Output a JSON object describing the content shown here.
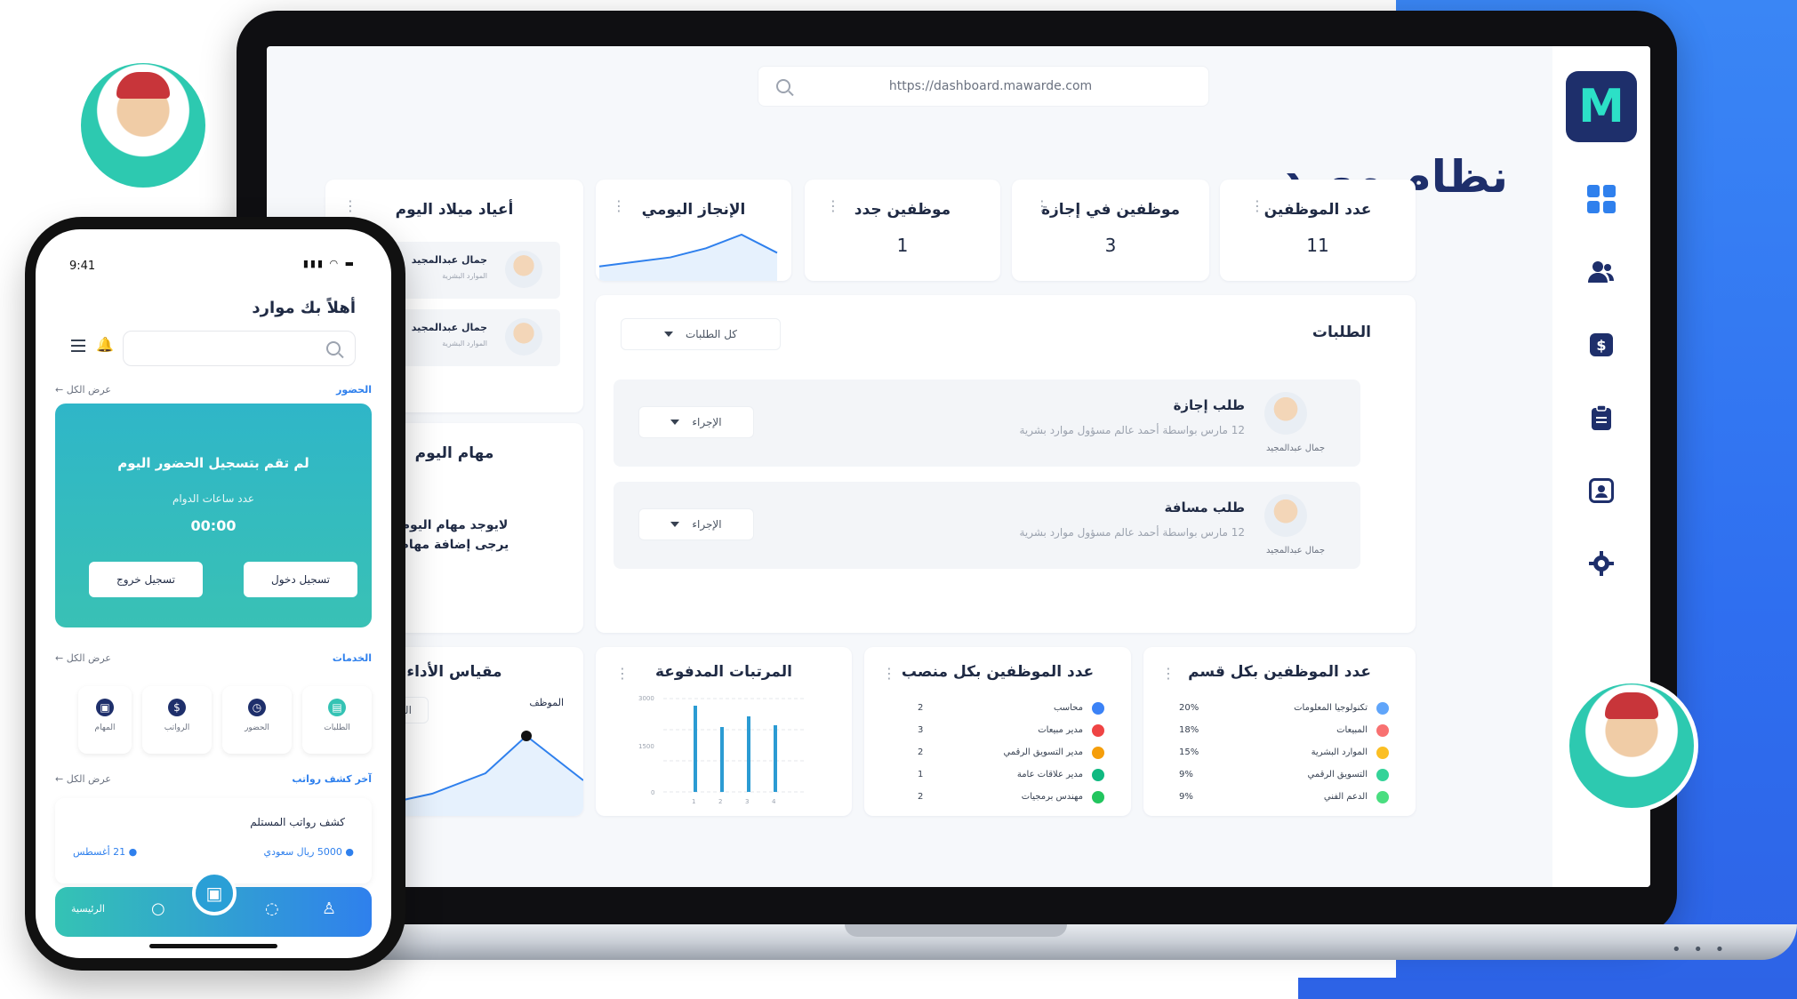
{
  "brand": {
    "logo_letter": "M",
    "accent": "#2f80ed",
    "navy": "#1e2f6b",
    "teal": "#34c3b4"
  },
  "browser": {
    "url": "https://dashboard.mawarde.com"
  },
  "page": {
    "title": "نظام مورد"
  },
  "sidebar": {
    "icons": [
      "dashboard-grid-icon",
      "users-icon",
      "dollar-icon",
      "clipboard-icon",
      "id-card-icon",
      "gear-icon"
    ]
  },
  "stats": [
    {
      "label": "عدد الموظفين",
      "value": "11"
    },
    {
      "label": "موظفين في إجازة",
      "value": "3"
    },
    {
      "label": "موظفين جدد",
      "value": "1"
    }
  ],
  "daily": {
    "title": "الإنجاز اليومي",
    "line": [
      2,
      3,
      4,
      6,
      9,
      5
    ]
  },
  "birthdays": {
    "title": "أعياد ميلاد اليوم",
    "items": [
      {
        "name": "جمال عبدالمجيد",
        "sub": "الموارد البشرية"
      },
      {
        "name": "جمال عبدالمجيد",
        "sub": "الموارد البشرية"
      }
    ]
  },
  "requests": {
    "title": "الطلبات",
    "filter": "كل الطلبات",
    "items": [
      {
        "type": "طلب إجازة",
        "desc": "12 مارس بواسطة أحمد عالم مسؤول موارد بشرية",
        "name": "جمال عبدالمجيد",
        "action": "الإجراء"
      },
      {
        "type": "طلب مسافة",
        "desc": "12 مارس بواسطة أحمد عالم مسؤول موارد بشرية",
        "name": "جمال عبدالمجيد",
        "action": "الإجراء"
      }
    ]
  },
  "tasks": {
    "title": "مهام اليوم",
    "body": "لايوجد مهام اليوم يرجى إضافة مهام"
  },
  "performance": {
    "title": "مقياس الأداء",
    "filter": "الشهر",
    "marker": "الموظف"
  },
  "payroll": {
    "title": "المرتبات المدفوعة",
    "y_ticks": [
      "3000",
      "1500",
      "0"
    ],
    "x_ticks": [
      "1",
      "2",
      "3",
      "4"
    ]
  },
  "by_position": {
    "title": "عدد الموظفين بكل منصب",
    "items": [
      {
        "label": "محاسب",
        "value": "2",
        "color": "#3b82f6"
      },
      {
        "label": "مدير مبيعات",
        "value": "3",
        "color": "#ef4444"
      },
      {
        "label": "مدير التسويق الرقمي",
        "value": "2",
        "color": "#f59e0b"
      },
      {
        "label": "مدير علاقات عامة",
        "value": "1",
        "color": "#10b981"
      },
      {
        "label": "مهندس برمجيات",
        "value": "2",
        "color": "#22c55e"
      }
    ]
  },
  "by_department": {
    "title": "عدد الموظفين بكل قسم",
    "items": [
      {
        "label": "تكنولوجيا المعلومات",
        "value": "20%",
        "color": "#60a5fa"
      },
      {
        "label": "المبيعات",
        "value": "18%",
        "color": "#f87171"
      },
      {
        "label": "الموارد البشرية",
        "value": "15%",
        "color": "#fbbf24"
      },
      {
        "label": "التسويق الرقمي",
        "value": "9%",
        "color": "#34d399"
      },
      {
        "label": "الدعم الفني",
        "value": "9%",
        "color": "#4ade80"
      }
    ]
  },
  "phone": {
    "time": "9:41",
    "greeting": "أهلاً بك موارد",
    "attendance_title": "الحضور",
    "see_all": "عرض الكل",
    "attendance_msg": "لم تقم بتسجيل الحضور اليوم",
    "work_hours_label": "عدد ساعات الدوام",
    "work_hours": "00:00",
    "check_in": "تسجيل دخول",
    "check_out": "تسجيل خروج",
    "services_title": "الخدمات",
    "services": [
      "الطلبات",
      "الحضور",
      "الرواتب",
      "المهام"
    ],
    "salary_title": "آخر كشف رواتب",
    "salary_card_title": "كشف رواتب المستلم",
    "salary_amount": "5000 ريال سعودي",
    "salary_date": "21 أغسطس",
    "nav_home": "الرئيسية"
  }
}
